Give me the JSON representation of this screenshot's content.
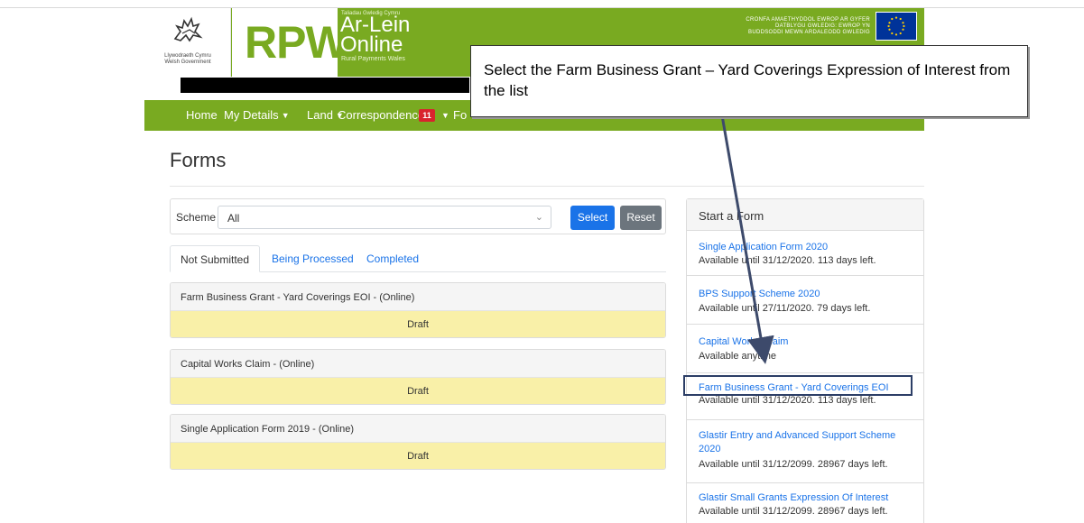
{
  "header": {
    "gov_text_line1": "Llywodraeth Cymru",
    "gov_text_line2": "Welsh Government",
    "logo_rpw": "RPW",
    "brand_top": "Taliadau Gwledig Cymru",
    "brand_line1": "Ar-Lein",
    "brand_line2": "Online",
    "brand_sub": "Rural Payments Wales",
    "eu_text_line1": "CRONFA AMAETHYDDOL EWROP AR GYFER",
    "eu_text_line2": "DATBLYGU GWLEDIG: EWROP YN",
    "eu_text_line3": "BUDDSODDI MEWN ARDALEODD GWLEDIG",
    "brand_color": "#79aa21"
  },
  "nav": {
    "home": "Home",
    "my_details": "My Details",
    "land": "Land",
    "correspondence": "Correspondence",
    "correspondence_count": "11",
    "forms_truncated": "Fo"
  },
  "page": {
    "title": "Forms"
  },
  "filter": {
    "label": "Scheme",
    "selected": "All",
    "select_button": "Select",
    "reset_button": "Reset"
  },
  "tabs": [
    {
      "label": "Not Submitted",
      "active": true
    },
    {
      "label": "Being Processed",
      "active": false
    },
    {
      "label": "Completed",
      "active": false
    }
  ],
  "forms": [
    {
      "title": "Farm Business Grant - Yard Coverings EOI - (Online)",
      "status": "Draft"
    },
    {
      "title": "Capital Works Claim - (Online)",
      "status": "Draft"
    },
    {
      "title": "Single Application Form 2019 - (Online)",
      "status": "Draft"
    }
  ],
  "start_form": {
    "heading": "Start a Form",
    "items": [
      {
        "link": "Single Application Form 2020",
        "sub": "Available until 31/12/2020. 113 days left."
      },
      {
        "link": "BPS Support Scheme 2020",
        "sub": "Available until 27/11/2020. 79 days left."
      },
      {
        "link": "Capital Works Claim",
        "sub": "Available anytime"
      },
      {
        "link": "Farm Business Grant - Yard Coverings EOI",
        "sub": "Available until 31/12/2020. 113 days left."
      },
      {
        "link_line1": "Glastir Entry and Advanced Support Scheme",
        "link_line2": "2020",
        "sub": "Available until 31/12/2099. 28967 days left."
      },
      {
        "link": "Glastir Small Grants Expression Of Interest",
        "sub": "Available until 31/12/2099. 28967 days left."
      }
    ]
  },
  "callout": {
    "text": "Select the Farm Business Grant – Yard Coverings Expression of Interest from the list"
  },
  "colors": {
    "link": "#1a73e8",
    "draft_bg": "#f9f0a8",
    "badge": "#d9232d",
    "highlight_border": "#2c3e66"
  }
}
